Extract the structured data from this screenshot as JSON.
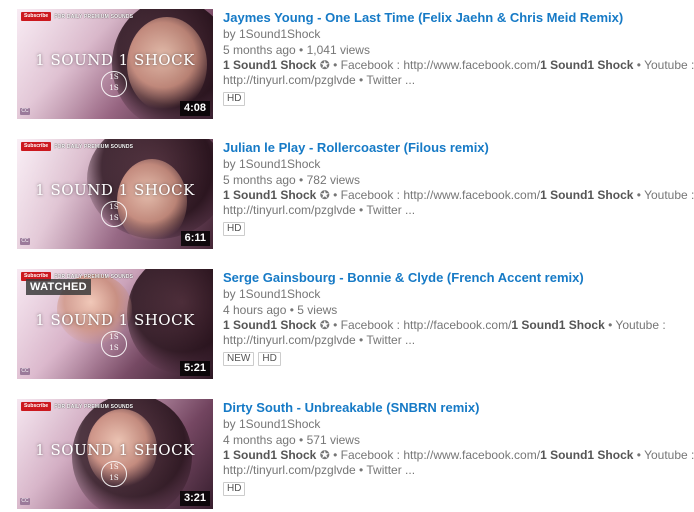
{
  "thumb_overlay": {
    "subscribe_label": "Subscribe",
    "channel_tag": "FOR DAILY PREMIUM SOUNDS",
    "logo_text": "1 SOUND 1 SHOCK",
    "seal_top": "1S",
    "seal_bottom": "1S",
    "cc_label": "CC"
  },
  "videos": [
    {
      "title": "Jaymes Young - One Last Time (Felix Jaehn & Chris Meid Remix)",
      "by": "by 1Sound1Shock",
      "age": "5 months ago",
      "views": "1,041 views",
      "desc_line1_bold": "1 Sound1 Shock",
      "desc_line1_mid": " • Facebook : http://www.facebook.com/",
      "desc_line1_bold2": "1 Sound1 Shock",
      "desc_line1_end": " • Youtube :",
      "desc_line2": "http://tinyurl.com/pzglvde • Twitter ...",
      "badge1": "HD",
      "duration": "4:08"
    },
    {
      "title": "Julian le Play - Rollercoaster (Filous remix)",
      "by": "by 1Sound1Shock",
      "age": "5 months ago",
      "views": "782 views",
      "desc_line1_bold": "1 Sound1 Shock",
      "desc_line1_mid": " • Facebook : http://www.facebook.com/",
      "desc_line1_bold2": "1 Sound1 Shock",
      "desc_line1_end": " • Youtube :",
      "desc_line2": "http://tinyurl.com/pzglvde • Twitter ...",
      "badge1": "HD",
      "duration": "6:11"
    },
    {
      "title": "Serge Gainsbourg - Bonnie & Clyde (French Accent remix)",
      "by": "by 1Sound1Shock",
      "age": "4 hours ago",
      "views": "5 views",
      "desc_line1_bold": "1 Sound1 Shock",
      "desc_line1_mid": " • Facebook : http://facebook.com/",
      "desc_line1_bold2": "1 Sound1 Shock",
      "desc_line1_end": " • Youtube :",
      "desc_line2": "http://tinyurl.com/pzglvde • Twitter ...",
      "badge1": "NEW",
      "badge2": "HD",
      "duration": "5:21",
      "watched": "WATCHED"
    },
    {
      "title": "Dirty South - Unbreakable (SNBRN remix)",
      "by": "by 1Sound1Shock",
      "age": "4 months ago",
      "views": "571 views",
      "desc_line1_bold": "1 Sound1 Shock",
      "desc_line1_mid": " • Facebook : http://www.facebook.com/",
      "desc_line1_bold2": "1 Sound1 Shock",
      "desc_line1_end": " • Youtube :",
      "desc_line2": "http://tinyurl.com/pzglvde • Twitter ...",
      "badge1": "HD",
      "duration": "3:21"
    }
  ],
  "separator": " • ",
  "verified_icon": "✪"
}
